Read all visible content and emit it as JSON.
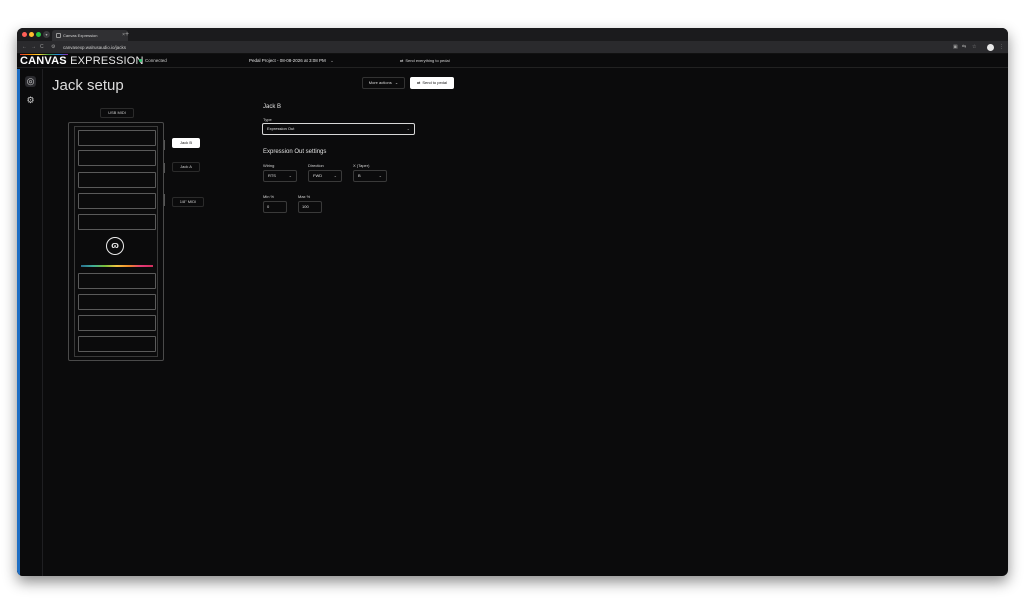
{
  "browser": {
    "tab_title": "Canvas Expression",
    "url": "canvasexp.walrusaudio.io/jacks",
    "new_tab": "+",
    "tab_close": "×"
  },
  "appbar": {
    "brand_bold": "CANVAS",
    "brand_light": "EXPRESSION",
    "status": "Connected",
    "project": "Pedal Project - 08-08-2026 at 3:08 PM",
    "send_all": "Send everything to pedal"
  },
  "page": {
    "title": "Jack setup",
    "more_actions": "More actions",
    "send_to_pedal": "Send to pedal"
  },
  "pedal": {
    "usb_midi": "USB MIDI",
    "jacks": [
      "Jack B",
      "Jack A",
      "1/8\" MIDI"
    ],
    "selected_jack": "Jack B"
  },
  "panel": {
    "heading": "Jack B",
    "type_label": "Type",
    "type_value": "Expression Out",
    "settings_heading": "Expression Out settings",
    "wiring_label": "Wiring",
    "wiring_value": "RTS",
    "direction_label": "Direction",
    "direction_value": "FWD",
    "x_label": "X (Taper)",
    "x_value": "B",
    "min_label": "Min %",
    "min_value": "0",
    "max_label": "Max %",
    "max_value": "100"
  },
  "colors": {
    "accent": "#1f6fc4",
    "connected": "#2ecc71",
    "background": "#0b0b0c"
  }
}
